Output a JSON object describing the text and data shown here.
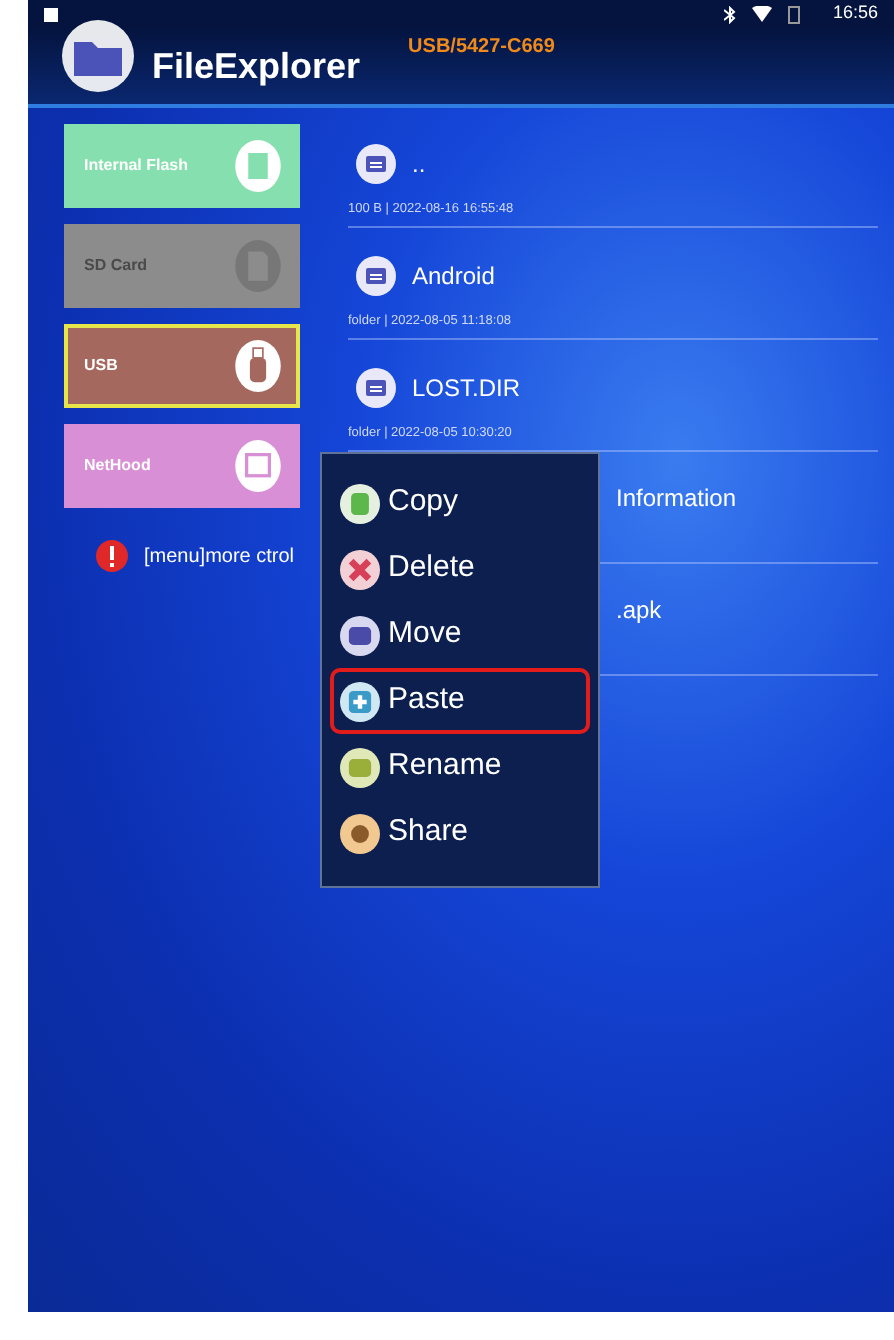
{
  "status_bar": {
    "time": "16:56"
  },
  "header": {
    "title": "FileExplorer",
    "path": "USB/5427-C669"
  },
  "storage": [
    {
      "label": "Internal Flash",
      "kind": "flash",
      "color": "#86dfae",
      "selected": false,
      "disabled": false
    },
    {
      "label": "SD Card",
      "kind": "sd",
      "color": "#8c8c8c",
      "selected": false,
      "disabled": true
    },
    {
      "label": "USB",
      "kind": "usb",
      "color": "#a5685f",
      "selected": true,
      "disabled": false
    },
    {
      "label": "NetHood",
      "kind": "network",
      "color": "#d88fd6",
      "selected": false,
      "disabled": false
    }
  ],
  "hint": "[menu]more ctrol",
  "files": [
    {
      "name": "..",
      "meta": "100 B | 2022-08-16 16:55:48"
    },
    {
      "name": "Android",
      "meta": "folder | 2022-08-05 11:18:08"
    },
    {
      "name": "LOST.DIR",
      "meta": "folder | 2022-08-05 10:30:20"
    },
    {
      "name": "Information",
      "kind": "covered"
    },
    {
      "name": ".apk",
      "kind": "covered"
    }
  ],
  "context_menu": [
    {
      "label": "Copy",
      "kind": "copy",
      "highlighted": false
    },
    {
      "label": "Delete",
      "kind": "delete",
      "highlighted": false
    },
    {
      "label": "Move",
      "kind": "move",
      "highlighted": false
    },
    {
      "label": "Paste",
      "kind": "paste",
      "highlighted": true
    },
    {
      "label": "Rename",
      "kind": "rename",
      "highlighted": false
    },
    {
      "label": "Share",
      "kind": "share",
      "highlighted": false
    }
  ]
}
